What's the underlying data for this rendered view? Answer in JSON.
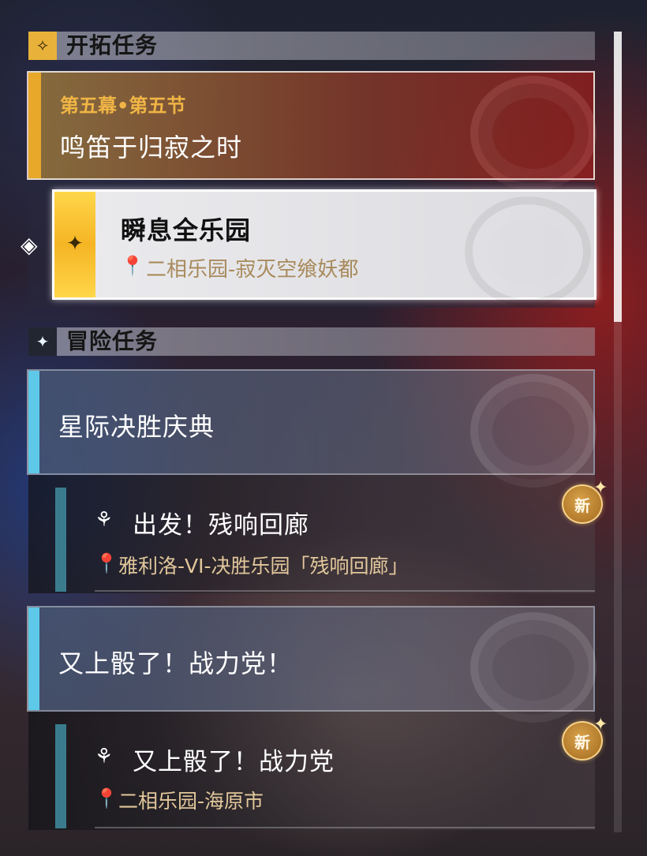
{
  "sections": {
    "trailblaze": {
      "title": "开拓任务",
      "icon": "trailblaze-compass-icon"
    },
    "adventure": {
      "title": "冒险任务",
      "icon": "adventure-star-icon"
    }
  },
  "trailblaze_mission": {
    "act": "第五幕•第五节",
    "title": "鸣笛于归寂之时",
    "selected_step": {
      "title": "瞬息全乐园",
      "location": "二相乐园-寂灭空飨妖都"
    }
  },
  "adventure_missions": [
    {
      "title": "星际决胜庆典",
      "quest": {
        "title": "出发！残响回廊",
        "location": "雅利洛-VI-决胜乐园「残响回廊」",
        "badge": "新"
      }
    },
    {
      "title": "又上骰了！战力党！",
      "quest": {
        "title": "又上骰了！战力党",
        "location": "二相乐园-海原市",
        "badge": "新"
      }
    }
  ],
  "colors": {
    "trailblaze_accent": "#e8a82a",
    "adventure_accent": "#5ec8e8",
    "location_text": "#e2c79b"
  }
}
